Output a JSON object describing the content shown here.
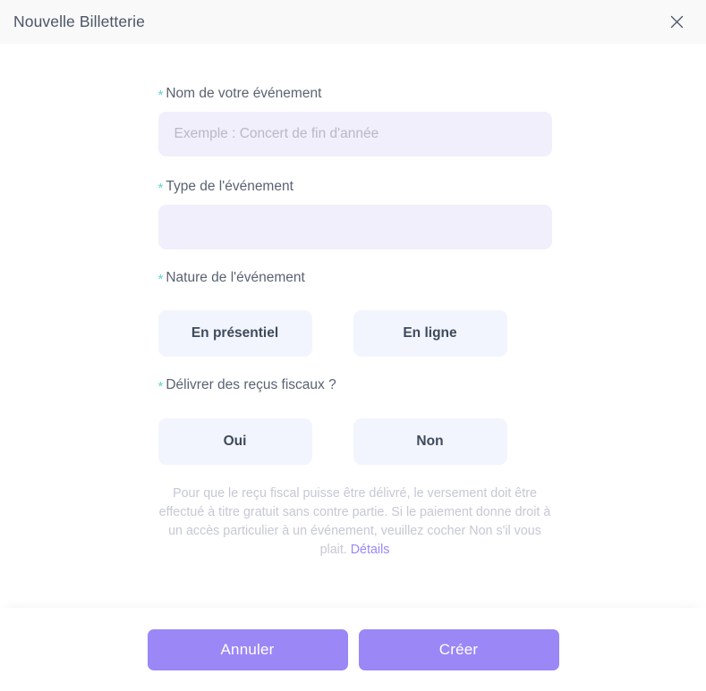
{
  "modal": {
    "title": "Nouvelle Billetterie",
    "close_icon": "close-icon"
  },
  "form": {
    "required_marker": "*",
    "fields": [
      {
        "label": "Nom de votre événement",
        "placeholder": "Exemple : Concert de fin d'année",
        "value": ""
      },
      {
        "label": "Type de l'événement",
        "placeholder": "",
        "value": ""
      }
    ],
    "nature": {
      "label": "Nature de l'événement",
      "options": [
        {
          "label": "En présentiel"
        },
        {
          "label": "En ligne"
        }
      ]
    },
    "receipts": {
      "label": "Délivrer des reçus fiscaux ?",
      "options": [
        {
          "label": "Oui"
        },
        {
          "label": "Non"
        }
      ],
      "helper_text": "Pour que le reçu fiscal puisse être délivré, le versement doit être effectué à titre gratuit sans contre partie. Si le paiement donne droit à un accès particulier à un événement, veuillez cocher Non s'il vous plait. ",
      "helper_link": "Détails"
    }
  },
  "footer": {
    "cancel_label": "Annuler",
    "create_label": "Créer"
  },
  "colors": {
    "accent_purple": "#9b87f5",
    "required_star": "#5ed3d8",
    "input_bg": "#f0effb",
    "choice_bg": "#f2f5fd",
    "header_bg": "#f9f9fa",
    "label_text": "#5a6272",
    "helper_text": "#c6c8d4"
  }
}
